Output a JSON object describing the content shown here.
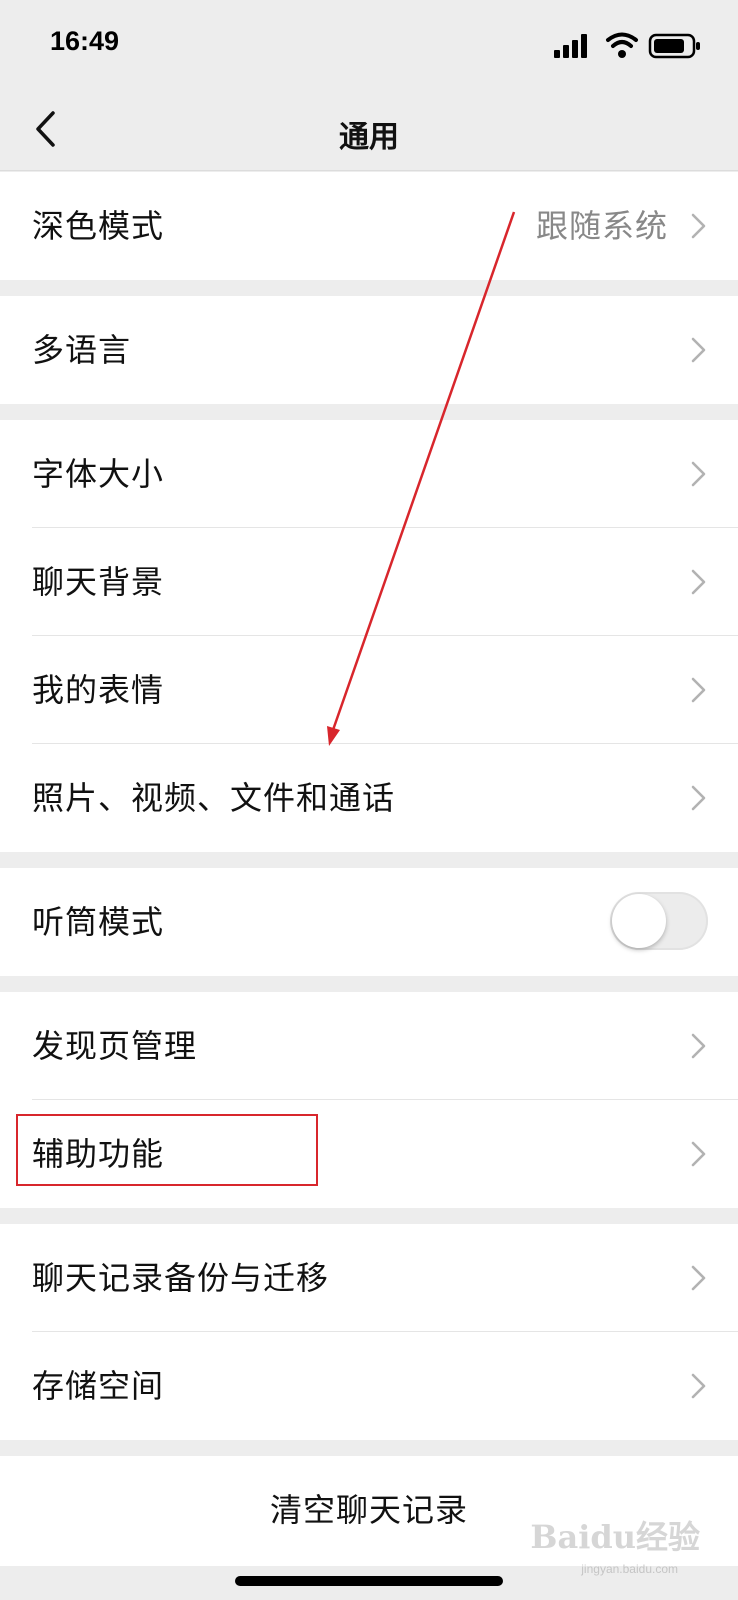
{
  "status_bar": {
    "time": "16:49"
  },
  "nav": {
    "title": "通用"
  },
  "groups": [
    {
      "rows": [
        {
          "label": "深色模式",
          "value": "跟随系统"
        }
      ]
    },
    {
      "rows": [
        {
          "label": "多语言"
        }
      ]
    },
    {
      "rows": [
        {
          "label": "字体大小"
        },
        {
          "label": "聊天背景"
        },
        {
          "label": "我的表情"
        },
        {
          "label": "照片、视频、文件和通话"
        }
      ]
    },
    {
      "rows": [
        {
          "label": "听筒模式",
          "toggle_on": false
        }
      ]
    },
    {
      "rows": [
        {
          "label": "发现页管理"
        },
        {
          "label": "辅助功能"
        }
      ]
    },
    {
      "rows": [
        {
          "label": "聊天记录备份与迁移"
        },
        {
          "label": "存储空间"
        }
      ]
    }
  ],
  "clear_button": {
    "label": "清空聊天记录"
  },
  "annotation": {
    "color": "#d8262c"
  },
  "watermark": {
    "text": "Baidu经验",
    "sub": "jingyan.baidu.com"
  }
}
